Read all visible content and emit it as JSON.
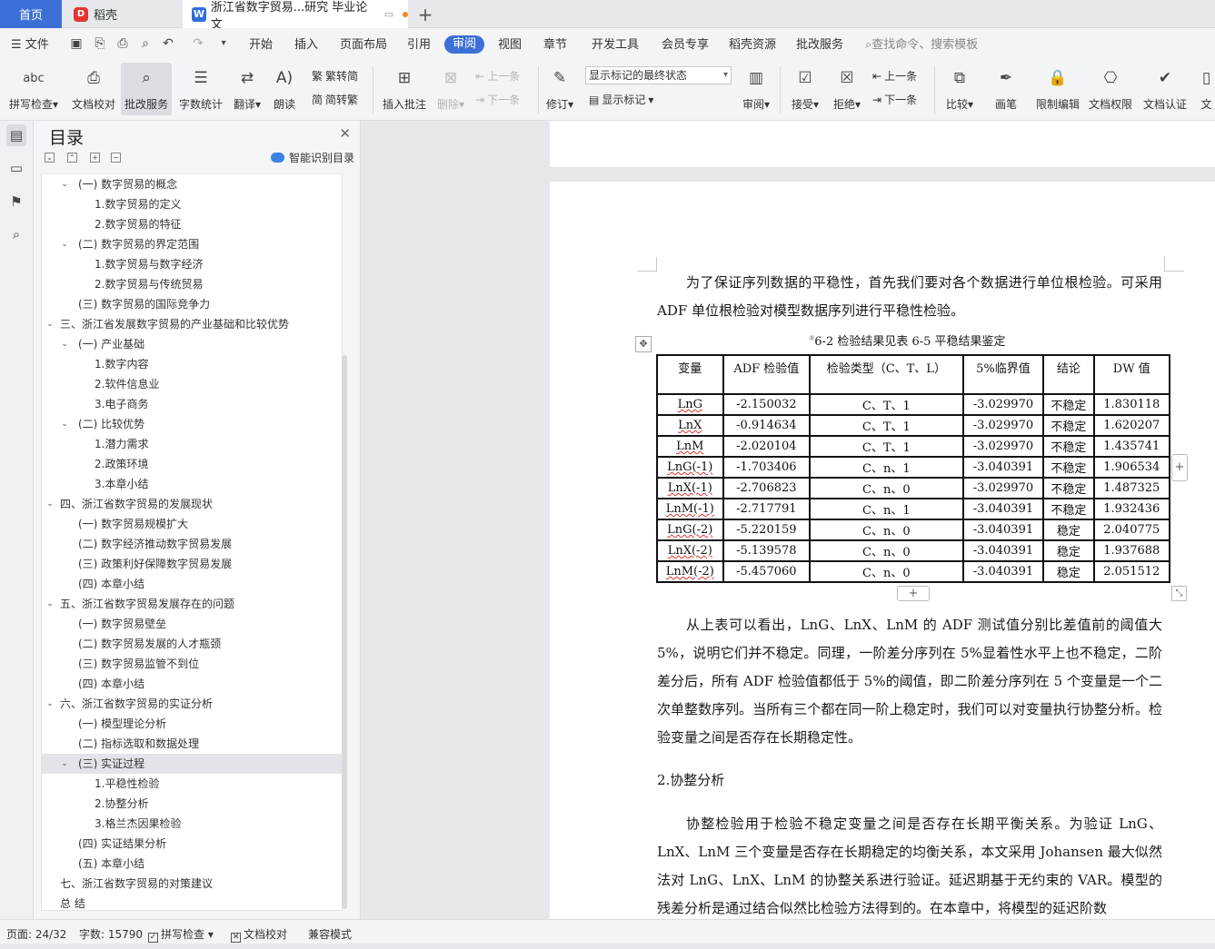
{
  "tabs": {
    "home": "首页",
    "daoke": "稻壳",
    "doc": "浙江省数字贸易...研究 毕业论文"
  },
  "menu": {
    "file": "文件",
    "items": [
      "开始",
      "插入",
      "页面布局",
      "引用",
      "审阅",
      "视图",
      "章节",
      "开发工具",
      "会员专享",
      "稻壳资源",
      "批改服务"
    ],
    "search": "查找命令、搜索模板"
  },
  "ribbon": {
    "spell": "拼写检查",
    "proof": "文档校对",
    "review_service": "批改服务",
    "word_count": "字数统计",
    "translate": "翻译",
    "read": "朗读",
    "trad": "繁转简",
    "simp": "简转繁",
    "insert_comment": "插入批注",
    "delete": "删除",
    "prev": "上一条",
    "next": "下一条",
    "track": "修订",
    "markup_combo": "显示标记的最终状态",
    "show_markup": "显示标记",
    "review": "审阅",
    "accept": "接受",
    "reject": "拒绝",
    "prev2": "上一条",
    "next2": "下一条",
    "compare": "比较",
    "pen": "画笔",
    "restrict": "限制编辑",
    "doc_rights": "文档权限",
    "doc_cert": "文档认证",
    "doc_more": "文"
  },
  "toc": {
    "title": "目录",
    "smart": "智能识别目录",
    "items": [
      {
        "text": "(一) 数字贸易的概念",
        "level": 1,
        "exp": true
      },
      {
        "text": "1.数字贸易的定义",
        "level": 2
      },
      {
        "text": "2.数字贸易的特征",
        "level": 2
      },
      {
        "text": "(二) 数字贸易的界定范围",
        "level": 1,
        "exp": true
      },
      {
        "text": "1.数字贸易与数字经济",
        "level": 2
      },
      {
        "text": "2.数字贸易与传统贸易",
        "level": 2
      },
      {
        "text": "(三) 数字贸易的国际竞争力",
        "level": 1
      },
      {
        "text": "三、浙江省发展数字贸易的产业基础和比较优势",
        "level": 0,
        "exp": true
      },
      {
        "text": "(一) 产业基础",
        "level": 1,
        "exp": true
      },
      {
        "text": "1.数字内容",
        "level": 2
      },
      {
        "text": "2.软件信息业",
        "level": 2
      },
      {
        "text": "3.电子商务",
        "level": 2
      },
      {
        "text": "(二) 比较优势",
        "level": 1,
        "exp": true
      },
      {
        "text": "1.潜力需求",
        "level": 2
      },
      {
        "text": "2.政策环境",
        "level": 2
      },
      {
        "text": "3.本章小结",
        "level": 2
      },
      {
        "text": "四、浙江省数字贸易的发展现状",
        "level": 0,
        "exp": true
      },
      {
        "text": "(一) 数字贸易规模扩大",
        "level": 1
      },
      {
        "text": "(二) 数字经济推动数字贸易发展",
        "level": 1
      },
      {
        "text": "(三) 政策利好保障数字贸易发展",
        "level": 1
      },
      {
        "text": "(四) 本章小结",
        "level": 1
      },
      {
        "text": "五、浙江省数字贸易发展存在的问题",
        "level": 0,
        "exp": true
      },
      {
        "text": "(一) 数字贸易壁垒",
        "level": 1
      },
      {
        "text": "(二) 数字贸易发展的人才瓶颈",
        "level": 1
      },
      {
        "text": "(三) 数字贸易监管不到位",
        "level": 1
      },
      {
        "text": "(四) 本章小结",
        "level": 1
      },
      {
        "text": "六、浙江省数字贸易的实证分析",
        "level": 0,
        "exp": true
      },
      {
        "text": "(一) 模型理论分析",
        "level": 1
      },
      {
        "text": "(二) 指标选取和数据处理",
        "level": 1
      },
      {
        "text": "(三) 实证过程",
        "level": 1,
        "exp": true,
        "selected": true
      },
      {
        "text": "1.平稳性检验",
        "level": 2
      },
      {
        "text": "2.协整分析",
        "level": 2
      },
      {
        "text": "3.格兰杰因果检验",
        "level": 2
      },
      {
        "text": "(四) 实证结果分析",
        "level": 1
      },
      {
        "text": "(五) 本章小结",
        "level": 1
      },
      {
        "text": "七、浙江省数字贸易的对策建议",
        "level": 0
      },
      {
        "text": "总  结",
        "level": 0
      }
    ]
  },
  "doc": {
    "para1": "为了保证序列数据的平稳性，首先我们要对各个数据进行单位根检验。可采用 ADF 单位根检验对模型数据序列进行平稳性检验。",
    "caption_sup": "⑨",
    "caption": "6-2 检验结果见表 6-5 平稳结果鉴定",
    "table": {
      "headers": [
        "变量",
        "ADF 检验值",
        "检验类型（C、T、L）",
        "5%临界值",
        "结论",
        "DW 值"
      ],
      "rows": [
        [
          "LnG",
          "-2.150032",
          "C、T、1",
          "-3.029970",
          "不稳定",
          "1.830118"
        ],
        [
          "LnX",
          "-0.914634",
          "C、T、1",
          "-3.029970",
          "不稳定",
          "1.620207"
        ],
        [
          "LnM",
          "-2.020104",
          "C、T、1",
          "-3.029970",
          "不稳定",
          "1.435741"
        ],
        [
          "LnG(-1)",
          "-1.703406",
          "C、n、1",
          "-3.040391",
          "不稳定",
          "1.906534"
        ],
        [
          "LnX(-1)",
          "-2.706823",
          "C、n、0",
          "-3.029970",
          "不稳定",
          "1.487325"
        ],
        [
          "LnM(-1)",
          "-2.717791",
          "C、n、1",
          "-3.040391",
          "不稳定",
          "1.932436"
        ],
        [
          "LnG(-2)",
          "-5.220159",
          "C、n、0",
          "-3.040391",
          "稳定",
          "2.040775"
        ],
        [
          "LnX(-2)",
          "-5.139578",
          "C、n、0",
          "-3.040391",
          "稳定",
          "1.937688"
        ],
        [
          "LnM(-2)",
          "-5.457060",
          "C、n、0",
          "-3.040391",
          "稳定",
          "2.051512"
        ]
      ]
    },
    "para2": "从上表可以看出，LnG、LnX、LnM 的 ADF 测试值分别比差值前的阈值大 5%，说明它们并不稳定。同理，一阶差分序列在 5%显着性水平上也不稳定，二阶差分后，所有 ADF 检验值都低于 5%的阈值，即二阶差分序列在 5 个变量是一个二次单整数序列。当所有三个都在同一阶上稳定时，我们可以对变量执行协整分析。检验变量之间是否存在长期稳定性。",
    "heading2": "2.协整分析",
    "para3": "协整检验用于检验不稳定变量之间是否存在长期平衡关系。为验证 LnG、LnX、LnM 三个变量是否存在长期稳定的均衡关系，本文采用 Johansen 最大似然法对 LnG、LnX、LnM 的协整关系进行验证。延迟期基于无约束的 VAR。模型的残差分析是通过结合似然比检验方法得到的。在本章中，将模型的延迟阶数"
  },
  "status": {
    "page": "页面: 24/32",
    "words": "字数: 15790",
    "spell": "拼写检查",
    "proof": "文档校对",
    "compat": "兼容模式"
  },
  "colors": {
    "accent": "#3c70d6",
    "selected_row": "#e1e4e9"
  }
}
